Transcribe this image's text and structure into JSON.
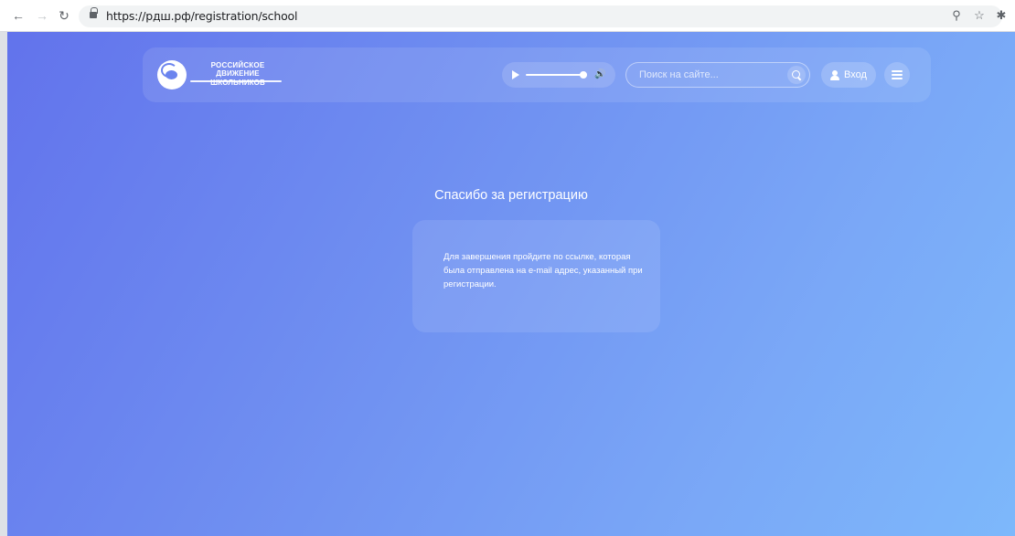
{
  "browser": {
    "url": "https://рдш.рф/registration/school"
  },
  "site": {
    "logo_line1": "Российское",
    "logo_line2": "движение школьников",
    "search_placeholder": "Поиск на сайте...",
    "login_label": "Вход",
    "audio_progress_fraction": 0.95
  },
  "main": {
    "title": "Спасибо за регистрацию",
    "message": "Для завершения пройдите по ссылке, которая была отправлена на e-mail адрес, указанный при регистрации."
  },
  "colors": {
    "gradient_start": "#6273ec",
    "gradient_end": "#7db8fb",
    "text": "#ffffff"
  }
}
